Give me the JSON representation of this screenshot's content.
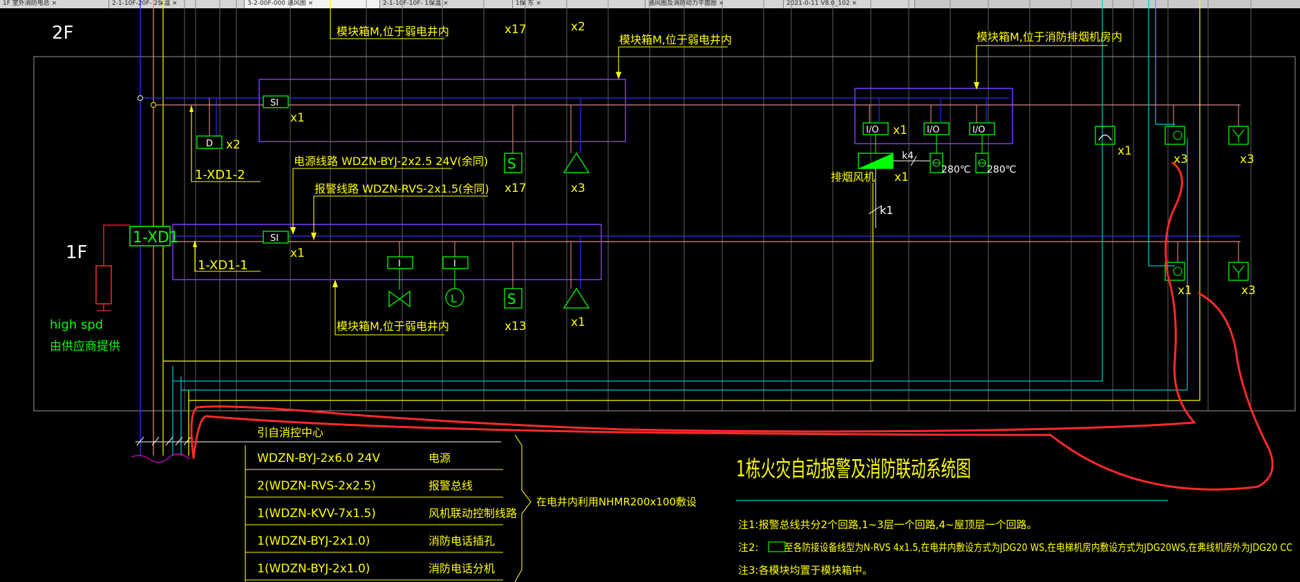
{
  "tabs": [
    {
      "label": "1F 室外消防电总 ×"
    },
    {
      "label": "2-1-10F-20F- 2保温 ×"
    },
    {
      "label": "3-2-00F-000 通风图 ×"
    },
    {
      "label": "2-1-10F-10F- 1保温 ×"
    },
    {
      "label": "1保 东 ×"
    },
    {
      "label": "通风图及消防动力平面图 ×"
    },
    {
      "label": "2021-0-11 V8.0_102 ×"
    }
  ],
  "floors": {
    "f2": "2F",
    "f1": "1F"
  },
  "main_panel": "1-XD1",
  "spd": {
    "label": "high spd",
    "note": "由供应商提供"
  },
  "subpanels": {
    "upper": "1-XD1-2",
    "lower": "1-XD1-1"
  },
  "module_boxes": {
    "top_left": "模块箱M,位于弱电井内",
    "top_mid": "模块箱M,位于弱电井内",
    "top_right": "模块箱M,位于消防排烟机房内",
    "bottom": "模块箱M,位于弱电井内"
  },
  "wire_labels": {
    "power": "电源线路  WDZN-BYJ-2x2.5  24V(余同)",
    "alarm": "报警线路  WDZN-RVS-2x1.5(余同)"
  },
  "device_labels": {
    "si": "SI",
    "d": "D",
    "io": "I/O",
    "i": "I",
    "l": "L",
    "s": "S",
    "temp": "280℃",
    "fan": "排烟风机",
    "k1": "k1"
  },
  "counts": {
    "x1": "x1",
    "x2": "x2",
    "x3": "x3",
    "x13": "x13",
    "x17": "x17"
  },
  "source_label": "引自消控中心",
  "cable_table": [
    {
      "spec": "WDZN-BYJ-2x6.0  24V",
      "purpose": "电源"
    },
    {
      "spec": "2(WDZN-RVS-2x2.5)",
      "purpose": "报警总线"
    },
    {
      "spec": "1(WDZN-KVV-7x1.5)",
      "purpose": "风机联动控制线路"
    },
    {
      "spec": "1(WDZN-BYJ-2x1.0)",
      "purpose": "消防电话插孔"
    },
    {
      "spec": "1(WDZN-BYJ-2x1.0)",
      "purpose": "消防电话分机"
    }
  ],
  "bracket_note": "在电井内利用NHMR200x100敷设",
  "title": "1栋火灾自动报警及消防联动系统图",
  "notes": [
    "注1:报警总线共分2个回路,1~3层一个回路,4~屋顶层一个回路。",
    "注2:",
    "至各防接设备线型为N-RVS 4x1.5,在电井内敷设方式为JDG20 WS,在电梯机房内敷设方式为JDG20WS,在弗线机房外为JDG20 CC",
    "注3:各模块均置于模块箱中。"
  ],
  "colors": {
    "white": "#ffffff",
    "yellow": "#ffff00",
    "green": "#00ff00",
    "blue": "#3030ff",
    "purple": "#7a3cff",
    "red": "#ff2a2a",
    "cyan": "#00c8d8",
    "pink": "#e08a8a",
    "gray": "#9a9a9a",
    "magenta": "#e000e0"
  }
}
